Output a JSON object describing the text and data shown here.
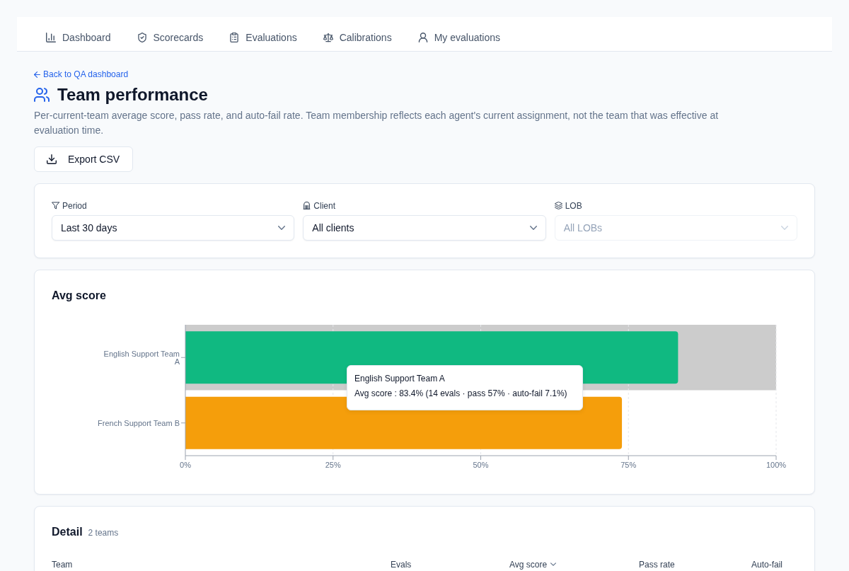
{
  "nav": {
    "items": [
      {
        "label": "Dashboard",
        "selected": false
      },
      {
        "label": "Scorecards",
        "selected": false
      },
      {
        "label": "Evaluations",
        "selected": false
      },
      {
        "label": "Calibrations",
        "selected": false
      },
      {
        "label": "My evaluations",
        "selected": false
      }
    ]
  },
  "back_link": {
    "label": "Back to QA dashboard"
  },
  "page_title": "Team performance",
  "description": "Per-current-team average score, pass rate, and auto-fail rate. Team membership reflects each agent's current assignment, not the team that was effective at evaluation time.",
  "export_button": {
    "label": "Export CSV"
  },
  "filters": [
    {
      "label": "Period",
      "value": "Last 30 days",
      "disabled": false
    },
    {
      "label": "Client",
      "value": "All clients",
      "disabled": false
    },
    {
      "label": "LOB",
      "value": "All LOBs",
      "disabled": true
    }
  ],
  "score_chart": {
    "chart_data": {
      "type": "bar",
      "orientation": "horizontal",
      "title": "Avg score",
      "categories": [
        "English Support Team A",
        "French Support Team B"
      ],
      "series": [
        {
          "colors": [
            "#10b981",
            "#f59e0b"
          ],
          "values": [
            83.4,
            73.9
          ]
        }
      ],
      "xlim": [
        0,
        100
      ],
      "xticks": [
        {
          "value": 0,
          "label": "0%"
        },
        {
          "value": 25,
          "label": "25%"
        },
        {
          "value": 50,
          "label": "50%"
        },
        {
          "value": 75,
          "label": "75%"
        },
        {
          "value": 100,
          "label": "100%"
        }
      ],
      "grid": true,
      "bands": [
        {
          "axis": "y",
          "from": "English Support Team A",
          "to": "English Support Team A",
          "color": "#cccccc"
        }
      ]
    },
    "tooltip": {
      "title": "English Support Team A",
      "text": "Avg score : 83.4% (14 evals · pass 57% · auto-fail 7.1%)"
    }
  },
  "detail": {
    "title": "Detail",
    "count": "2 teams",
    "columns": [
      {
        "label": "Team",
        "sorted": false
      },
      {
        "label": "Evals",
        "sorted": false
      },
      {
        "label": "Avg score",
        "sorted": true
      },
      {
        "label": "Pass rate",
        "sorted": false
      },
      {
        "label": "Auto-fail",
        "sorted": false
      }
    ]
  }
}
